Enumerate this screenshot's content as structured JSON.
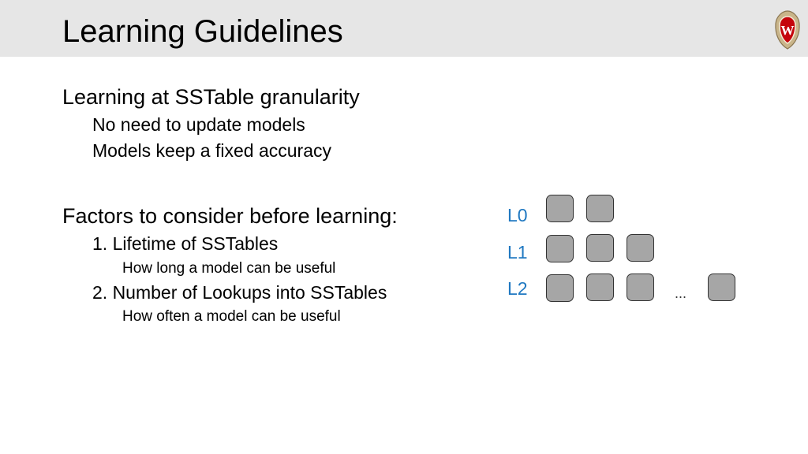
{
  "slide": {
    "title": "Learning Guidelines",
    "logo": "uw-madison-crest-icon"
  },
  "section1": {
    "heading": "Learning at SSTable granularity",
    "points": [
      "No need to update models",
      "Models keep a fixed accuracy"
    ]
  },
  "section2": {
    "heading": "Factors to consider before learning:",
    "factors": [
      {
        "label": "1. Lifetime of SSTables",
        "detail": "How long a model can be useful"
      },
      {
        "label": "2. Number of Lookups into SSTables",
        "detail": "How often a model can be useful"
      }
    ]
  },
  "diagram": {
    "levels": [
      {
        "label": "L0",
        "blocks": 2
      },
      {
        "label": "L1",
        "blocks": 3
      },
      {
        "label": "L2",
        "blocks": 4,
        "ellipsis": "..."
      }
    ],
    "colors": {
      "label": "#1f78c1",
      "block_fill": "#a6a6a6",
      "block_border": "#333333"
    }
  }
}
